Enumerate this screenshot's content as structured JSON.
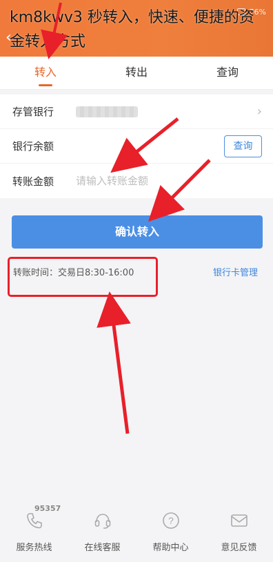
{
  "overlay_caption": "km8kwv3 秒转入，快速、便捷的资金转入方式",
  "status": {
    "battery": "76%"
  },
  "tabs": [
    {
      "label": "转入",
      "active": true
    },
    {
      "label": "转出",
      "active": false
    },
    {
      "label": "查询",
      "active": false
    }
  ],
  "form": {
    "bank_label": "存管银行",
    "balance_label": "银行余额",
    "balance_query_label": "查询",
    "amount_label": "转账金额",
    "amount_placeholder": "请输入转账金额"
  },
  "confirm_label": "确认转入",
  "transfer_time": "转账时间：交易日8:30-16:00",
  "bank_card_manage": "银行卡管理",
  "bottom_nav": [
    {
      "label": "服务热线",
      "icon": "phone-icon",
      "badge": "95357"
    },
    {
      "label": "在线客服",
      "icon": "headset-icon"
    },
    {
      "label": "帮助中心",
      "icon": "help-icon"
    },
    {
      "label": "意见反馈",
      "icon": "mail-icon"
    }
  ],
  "colors": {
    "header": "#ef7f3d",
    "accent": "#e8662b",
    "primary_button": "#4b8fe5",
    "link": "#3f86dc",
    "annotation": "#e8202a"
  }
}
